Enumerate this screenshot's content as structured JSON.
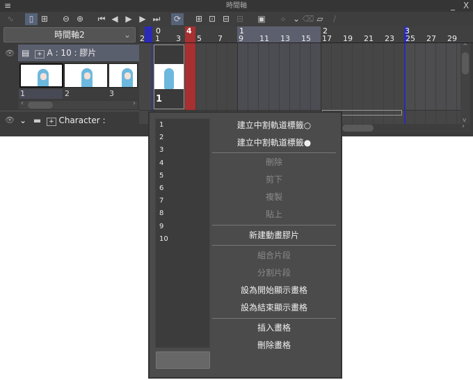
{
  "window": {
    "title": "時間軸",
    "minimize": "_",
    "close": "X",
    "menu_icon": "≡"
  },
  "toolbar": [
    {
      "icon": "graph-icon",
      "glyph": "∿",
      "state": "dim"
    },
    {
      "icon": "frame-view-icon",
      "glyph": "▯",
      "state": "on"
    },
    {
      "icon": "new-frame-track-icon",
      "glyph": "⊞",
      "state": "normal"
    },
    {
      "icon": "zoom-out-icon",
      "glyph": "⊖",
      "state": "normal"
    },
    {
      "icon": "zoom-in-icon",
      "glyph": "⊕",
      "state": "normal"
    },
    {
      "icon": "first-frame-icon",
      "glyph": "⏮",
      "state": "normal"
    },
    {
      "icon": "prev-frame-icon",
      "glyph": "◀",
      "state": "normal"
    },
    {
      "icon": "play-icon",
      "glyph": "▶",
      "state": "normal"
    },
    {
      "icon": "next-frame-icon",
      "glyph": "▶",
      "state": "normal"
    },
    {
      "icon": "last-frame-icon",
      "glyph": "⏭",
      "state": "normal"
    },
    {
      "icon": "loop-icon",
      "glyph": "⟳",
      "state": "on"
    },
    {
      "icon": "new-animation-folder-icon",
      "glyph": "⊞",
      "state": "normal"
    },
    {
      "icon": "new-cel-icon",
      "glyph": "⊡",
      "state": "normal"
    },
    {
      "icon": "specify-cel-icon",
      "glyph": "⊟",
      "state": "normal"
    },
    {
      "icon": "unlink-cel-icon",
      "glyph": "⊟",
      "state": "dim"
    },
    {
      "icon": "onion-skin-icon",
      "glyph": "▣",
      "state": "normal"
    },
    {
      "icon": "keyframe-icon",
      "glyph": "⟡",
      "state": "dim"
    },
    {
      "icon": "chevron-down-icon",
      "glyph": "⌄",
      "state": "normal"
    },
    {
      "icon": "delete-keyframe-icon",
      "glyph": "⌫",
      "state": "dim"
    },
    {
      "icon": "edit-cel-icon",
      "glyph": "▱",
      "state": "normal"
    },
    {
      "icon": "pen-icon",
      "glyph": "∕",
      "state": "dim"
    }
  ],
  "timeline_select": {
    "value": "時間軸2"
  },
  "ruler": {
    "frame_labels": [
      "2",
      "1",
      "3",
      "5",
      "7",
      "9",
      "11",
      "13",
      "15",
      "17",
      "19",
      "21",
      "23",
      "25",
      "27",
      "29"
    ],
    "section_labels": [
      "0",
      "4",
      "1",
      "2",
      "3"
    ],
    "current_frame": "4",
    "colors": {
      "current": "#a83030",
      "marker": "#2a2ab8",
      "section": "#5c5f6e"
    }
  },
  "tracks": [
    {
      "name": "A : 10 : 膠片",
      "cells": [
        "1",
        "2",
        "3"
      ],
      "timeline_cell": "1"
    },
    {
      "name": "Character :"
    }
  ],
  "context_menu": {
    "list": [
      "1",
      "2",
      "3",
      "4",
      "5",
      "6",
      "7",
      "8",
      "9",
      "10"
    ],
    "items": [
      {
        "label": "建立中割軌道標籤○",
        "enabled": true
      },
      {
        "label": "建立中割軌道標籤●",
        "enabled": true
      },
      {
        "label": "刪除",
        "enabled": false
      },
      {
        "label": "剪下",
        "enabled": false
      },
      {
        "label": "複製",
        "enabled": false
      },
      {
        "label": "貼上",
        "enabled": false
      },
      {
        "label": "新建動畫膠片",
        "enabled": true
      },
      {
        "label": "組合片段",
        "enabled": false
      },
      {
        "label": "分割片段",
        "enabled": false
      },
      {
        "label": "設為開始顯示畫格",
        "enabled": true
      },
      {
        "label": "設為結束顯示畫格",
        "enabled": true
      },
      {
        "label": "插入畫格",
        "enabled": true
      },
      {
        "label": "刪除畫格",
        "enabled": true
      }
    ]
  }
}
